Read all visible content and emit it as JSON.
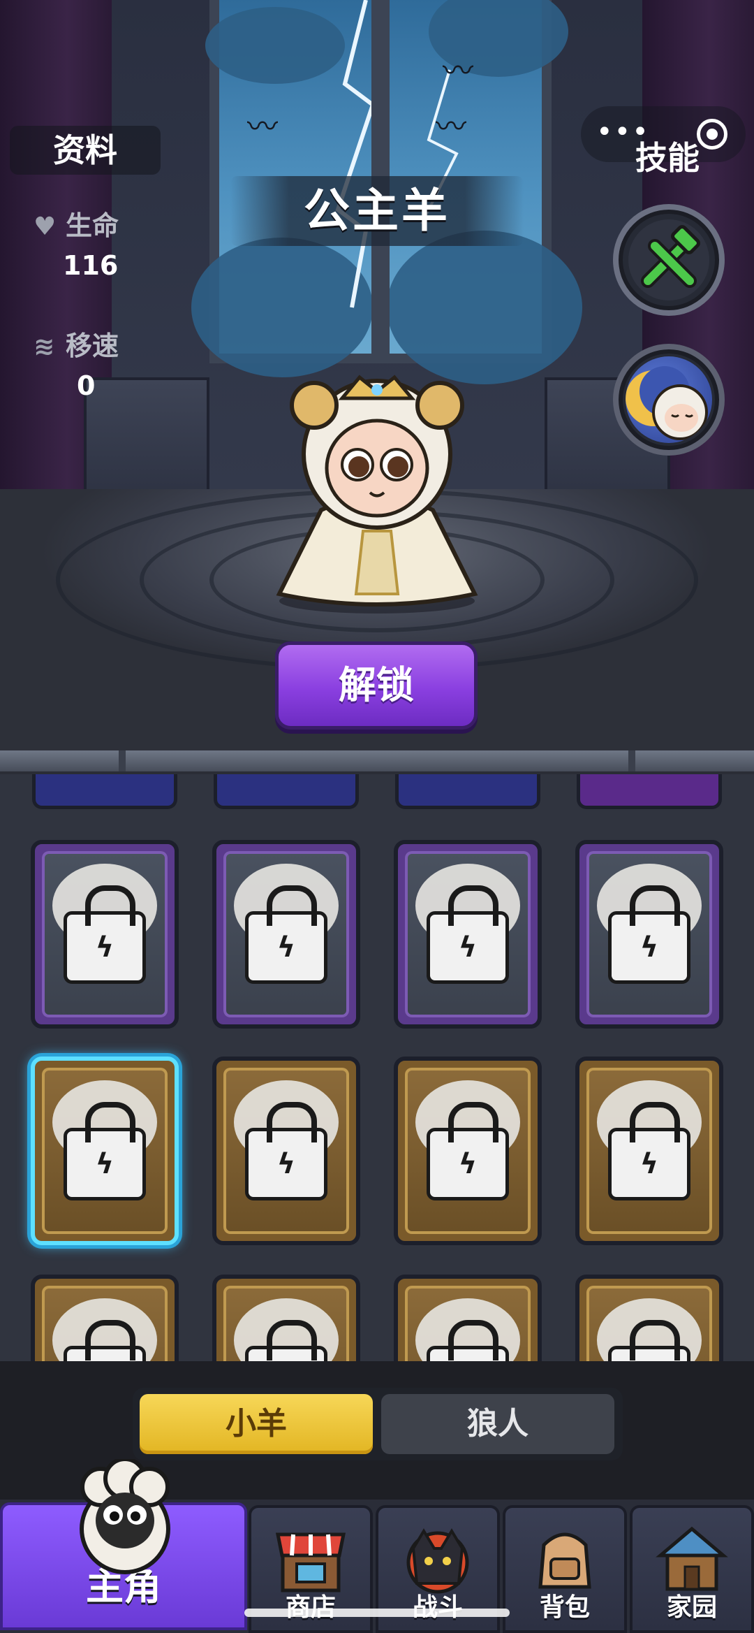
{
  "info": {
    "title": "资料",
    "stats": [
      {
        "label": "生命",
        "value": "116",
        "icon": "heart-icon"
      },
      {
        "label": "移速",
        "value": "0",
        "icon": "speed-boot-icon"
      }
    ]
  },
  "skills": {
    "title": "技能",
    "buttons": [
      {
        "name": "tools-skill",
        "icon": "wrench-hammer-icon",
        "color": "#4cc84a"
      },
      {
        "name": "character-portrait-skill",
        "icon": "sleeping-sheep-icon"
      }
    ]
  },
  "character": {
    "name": "公主羊"
  },
  "unlock": {
    "label": "解锁",
    "color": "#8a3fe0"
  },
  "collection": {
    "rows": [
      {
        "cards": [
          {
            "frame": "purple",
            "locked": true
          },
          {
            "frame": "purple",
            "locked": true
          },
          {
            "frame": "purple",
            "locked": true
          },
          {
            "frame": "purple",
            "locked": true
          }
        ]
      },
      {
        "cards": [
          {
            "frame": "gold",
            "locked": true,
            "selected": true
          },
          {
            "frame": "gold",
            "locked": true
          },
          {
            "frame": "gold",
            "locked": true
          },
          {
            "frame": "gold",
            "locked": true
          }
        ]
      },
      {
        "cards": [
          {
            "frame": "gold",
            "locked": true
          },
          {
            "frame": "gold",
            "locked": true
          },
          {
            "frame": "gold",
            "locked": true
          },
          {
            "frame": "gold",
            "locked": true
          }
        ]
      }
    ]
  },
  "toggle": {
    "options": [
      "小羊",
      "狼人"
    ],
    "selected": "小羊"
  },
  "nav": {
    "items": [
      {
        "label": "主角",
        "icon": "sheep-mascot-icon",
        "active": true
      },
      {
        "label": "商店",
        "icon": "shop-stall-icon",
        "active": false
      },
      {
        "label": "战斗",
        "icon": "wolf-battle-icon",
        "active": false
      },
      {
        "label": "背包",
        "icon": "backpack-icon",
        "active": false
      },
      {
        "label": "家园",
        "icon": "house-icon",
        "active": false
      }
    ]
  }
}
